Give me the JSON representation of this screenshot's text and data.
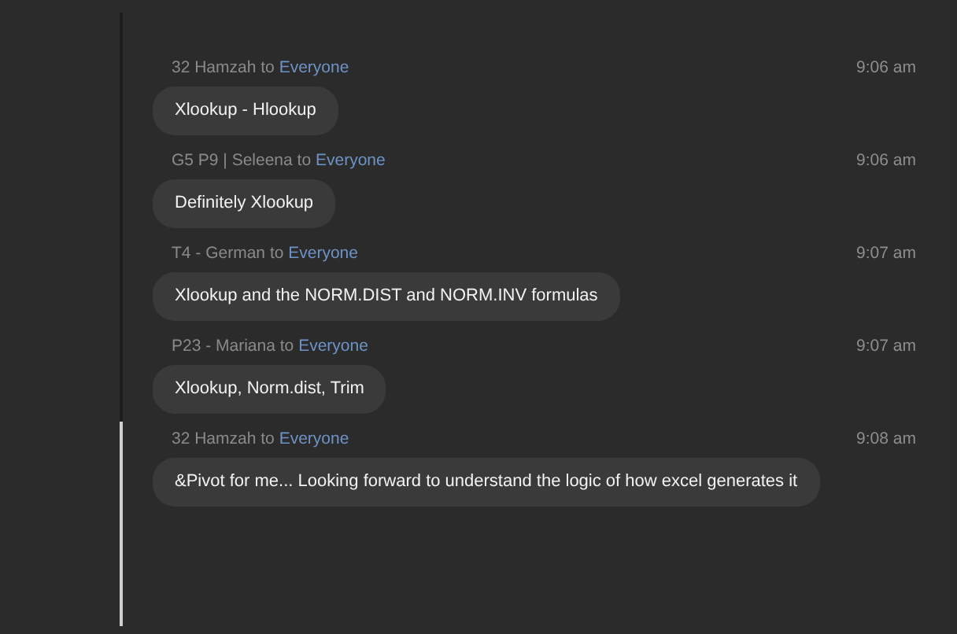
{
  "messages": [
    {
      "sender": "32 Hamzah",
      "to": "to",
      "recipient": "Everyone",
      "time": "9:06 am",
      "text": "Xlookup - Hlookup"
    },
    {
      "sender": "G5 P9 | Seleena",
      "to": "to",
      "recipient": "Everyone",
      "time": "9:06 am",
      "text": "Definitely Xlookup"
    },
    {
      "sender": "T4 - German",
      "to": "to",
      "recipient": "Everyone",
      "time": "9:07 am",
      "text": "Xlookup and the NORM.DIST and NORM.INV formulas"
    },
    {
      "sender": "P23 - Mariana",
      "to": "to",
      "recipient": "Everyone",
      "time": "9:07 am",
      "text": "Xlookup, Norm.dist, Trim"
    },
    {
      "sender": "32 Hamzah",
      "to": "to",
      "recipient": "Everyone",
      "time": "9:08 am",
      "text": "&Pivot for me... Looking forward to understand the logic of how excel generates it"
    }
  ]
}
